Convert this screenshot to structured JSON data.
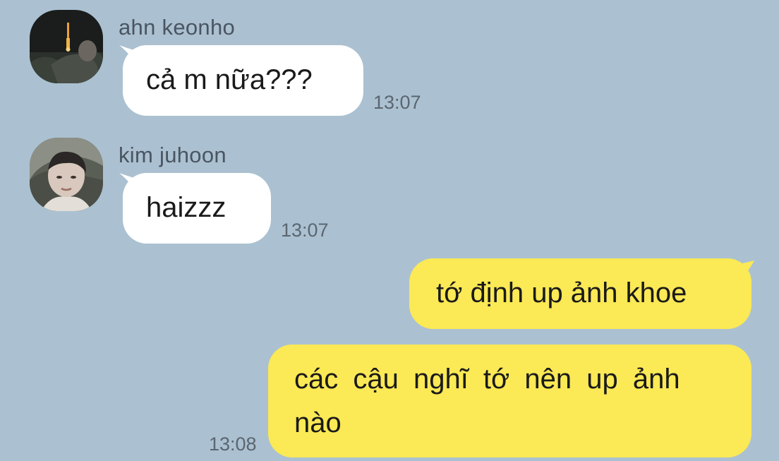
{
  "colors": {
    "background": "#abc1d1",
    "incoming_bubble": "#ffffff",
    "outgoing_bubble": "#fbe955",
    "sender_text": "#4a5561",
    "timestamp_text": "#5b6670"
  },
  "messages": [
    {
      "direction": "incoming",
      "sender": "ahn keonho",
      "avatar": "profile-photo-night-sky",
      "text": "cả m nữa???",
      "time": "13:07"
    },
    {
      "direction": "incoming",
      "sender": "kim juhoon",
      "avatar": "profile-photo-selfie",
      "text": "haizzz",
      "time": "13:07"
    },
    {
      "direction": "outgoing",
      "text": "tớ định up ảnh khoe",
      "time": ""
    },
    {
      "direction": "outgoing",
      "text": "các cậu nghĩ tớ nên up ảnh nào",
      "time": "13:08"
    }
  ]
}
